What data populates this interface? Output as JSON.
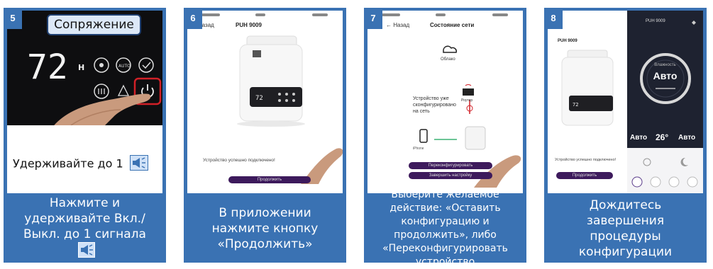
{
  "steps": [
    {
      "number": "5",
      "tag": "Сопряжение",
      "display_value": "72",
      "display_unit": "H",
      "panel_text": "Удерживайте до 1",
      "caption": "Нажмите и удерживайте Вкл./Выкл. до 1 сигнала"
    },
    {
      "number": "6",
      "nav_back": "< Назад",
      "screen_title": "PUH 9009",
      "status_text": "Устройство успешно подключено!",
      "button_label": "Продолжить",
      "caption": "В приложении нажмите кнопку «Продолжить»"
    },
    {
      "number": "7",
      "nav_back": "← Назад",
      "screen_title": "Состояние сети",
      "cloud_label": "Облако",
      "info_text": "Устройство уже сконфигурировано на сеть",
      "router_label": "Роутер",
      "phone_label": "iPhone",
      "btn_reconfigure": "Переконфигурировать",
      "btn_finish": "Завершить настройку",
      "caption": "Выберите желаемое действие: «Оставить конфигурацию и продолжить», либо «Переконфигурировать устройство"
    },
    {
      "number": "8",
      "screen_title": "PUH 9009",
      "status_text": "Устройство успешно подключено!",
      "button_label": "Продолжить",
      "app_title": "PUH 9009",
      "dial_label": "Влажность",
      "dial_mode": "Авто",
      "stat1_value": "Авто",
      "stat2_value": "26°",
      "stat3_value": "Авто",
      "caption": "Дождитесь завершения процедуры конфигурации"
    }
  ],
  "colors": {
    "panel_blue": "#3a72b3",
    "button_purple": "#3d1a5c",
    "highlight_red": "#d12027"
  }
}
